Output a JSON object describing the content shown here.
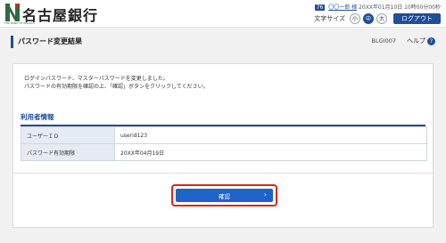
{
  "header": {
    "bank_name": "名古屋銀行",
    "logo_sub": "THE BANK OF NAGOYA",
    "user_badge": "76",
    "user_name": "〇〇一郎 様",
    "last_login": "20XX年01月10日 10時00分00秒",
    "font_size_label": "文字サイズ",
    "font_sizes": [
      "小",
      "中",
      "大"
    ],
    "font_size_selected": "中",
    "logout_label": "ログアウト"
  },
  "page": {
    "title": "パスワード変更結果",
    "screen_id": "BLGI007",
    "help_label": "ヘルプ",
    "help_icon_glyph": "?"
  },
  "message": {
    "line1": "ログインパスワード、マスターパスワードを変更しました。",
    "line2": "パスワードの有効期限を確認の上、「確認」ボタンをクリックしてください。"
  },
  "user_info": {
    "section_title": "利用者情報",
    "rows": [
      {
        "label": "ユーザーＩＤ",
        "value": "userid123"
      },
      {
        "label": "パスワード有効期限",
        "value": "20XX年04月19日"
      }
    ]
  },
  "actions": {
    "confirm_label": "確認",
    "confirm_chevron": "›"
  },
  "colors": {
    "brand_blue": "#1f4e9a",
    "button_blue": "#1f63c6",
    "highlight_red": "#e0251b",
    "logo_green": "#2d6a3e",
    "logo_red": "#d9261c"
  }
}
